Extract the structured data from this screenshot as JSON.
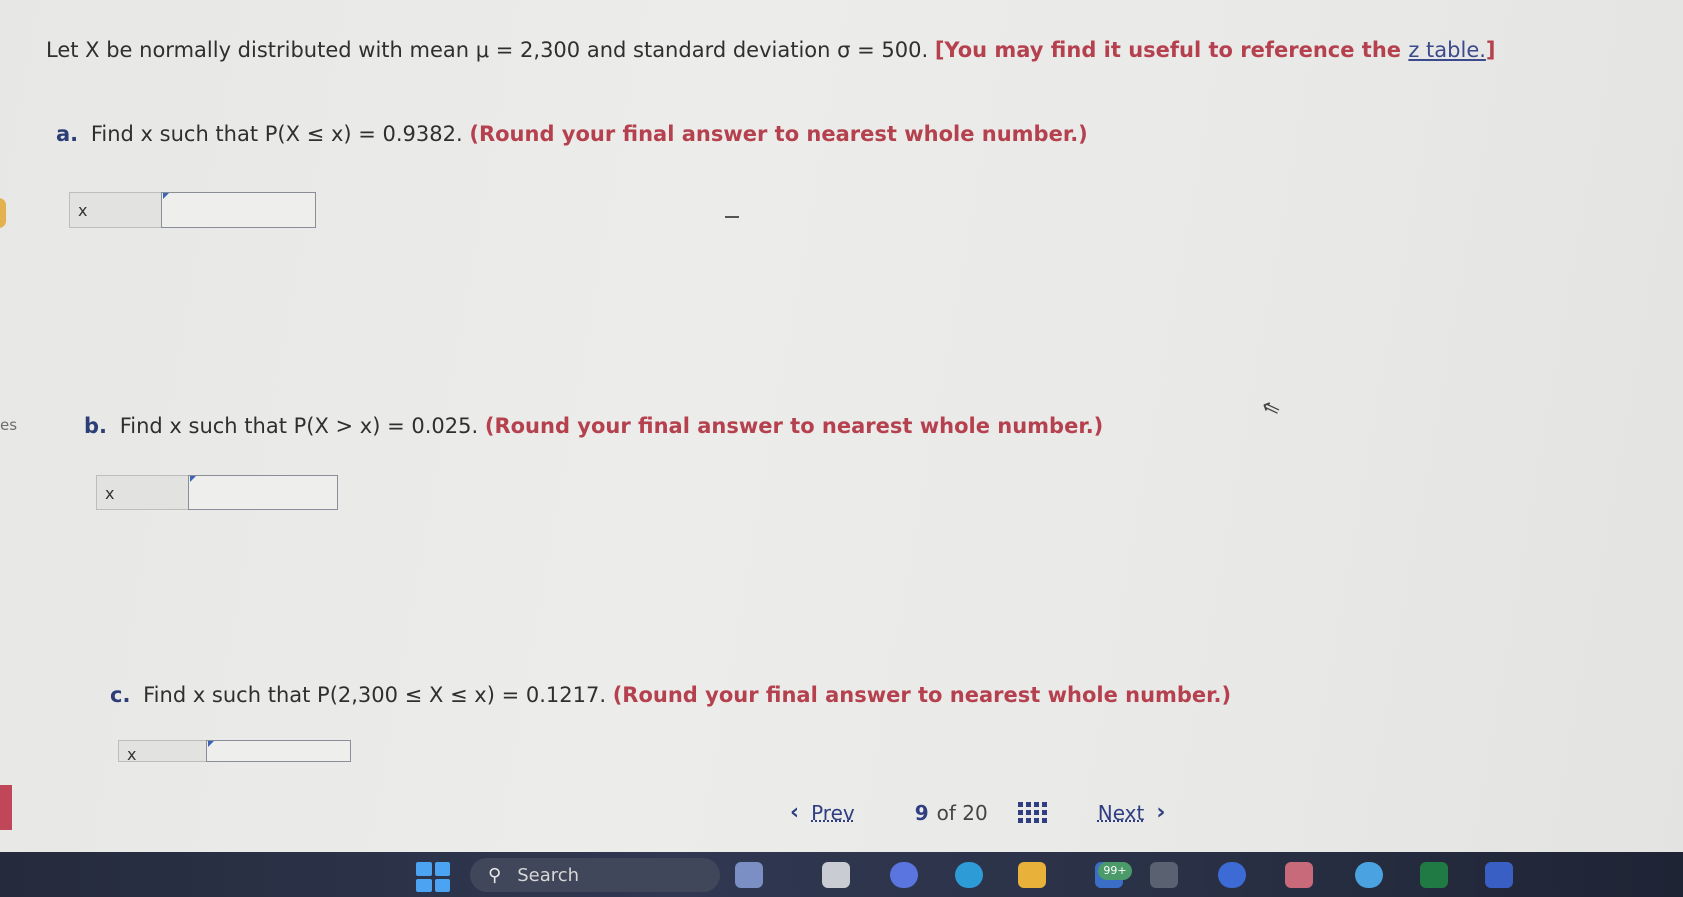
{
  "question": {
    "intro": "Let X be normally distributed with mean μ = 2,300 and standard deviation σ = 500.",
    "hint_prefix": "[You may find it useful to reference the",
    "hint_link": "z table.",
    "hint_suffix": "]"
  },
  "parts": [
    {
      "letter": "a.",
      "text": "Find x such that P(X ≤ x) = 0.9382.",
      "round": "(Round your final answer to nearest whole number.)",
      "label": "x",
      "value": ""
    },
    {
      "letter": "b.",
      "text": "Find x such that P(X > x) = 0.025.",
      "round": "(Round your final answer to nearest whole number.)",
      "label": "x",
      "value": ""
    },
    {
      "letter": "c.",
      "text": "Find x such that P(2,300 ≤ X ≤ x) = 0.1217.",
      "round": "(Round your final answer to nearest whole number.)",
      "label": "x",
      "value": ""
    }
  ],
  "side": {
    "tab_text": "es"
  },
  "nav": {
    "prev": "Prev",
    "prev_icon": "chevron-left-icon",
    "current": "9",
    "of_label": "of 20",
    "next": "Next",
    "next_icon": "chevron-right-icon"
  },
  "taskbar": {
    "search_placeholder": "Search",
    "badge": "99+",
    "colors": {
      "windows": "#4ca3f2",
      "accent": "#b5414f",
      "nav": "#2f3f82"
    }
  }
}
